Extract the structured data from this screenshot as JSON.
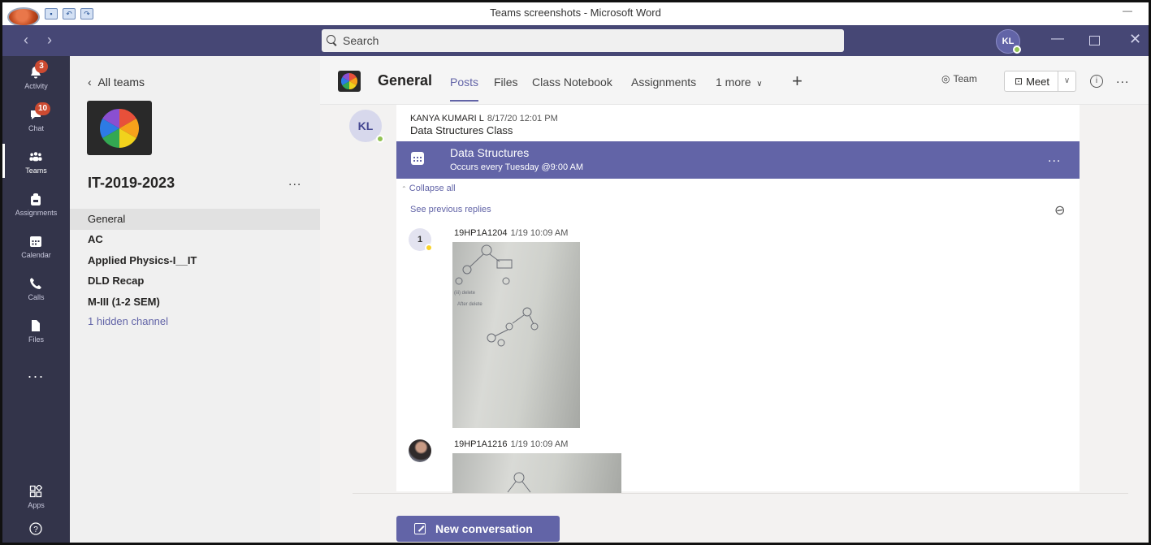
{
  "word": {
    "title": "Teams screenshots - Microsoft Word"
  },
  "search": {
    "placeholder": "Search"
  },
  "me": {
    "initials": "KL"
  },
  "rail": {
    "items": [
      {
        "label": "Activity",
        "badge": "3"
      },
      {
        "label": "Chat",
        "badge": "10"
      },
      {
        "label": "Teams",
        "badge": ""
      },
      {
        "label": "Assignments",
        "badge": ""
      },
      {
        "label": "Calendar",
        "badge": ""
      },
      {
        "label": "Calls",
        "badge": ""
      },
      {
        "label": "Files",
        "badge": ""
      }
    ],
    "more": "...",
    "apps": "Apps"
  },
  "channel_pane": {
    "back_label": "All teams",
    "team_name": "IT-2019-2023",
    "team_more": "...",
    "channels": [
      {
        "name": "General",
        "active": true,
        "bold": false
      },
      {
        "name": "AC",
        "active": false,
        "bold": true
      },
      {
        "name": "Applied Physics-I__IT",
        "active": false,
        "bold": true
      },
      {
        "name": "DLD Recap",
        "active": false,
        "bold": true
      },
      {
        "name": "M-III (1-2 SEM)",
        "active": false,
        "bold": true
      }
    ],
    "hidden_channels": "1 hidden channel"
  },
  "header": {
    "title": "General",
    "tabs": [
      "Posts",
      "Files",
      "Class Notebook",
      "Assignments",
      "1 more"
    ],
    "team_label": "Team",
    "meet_label": "Meet",
    "more": "..."
  },
  "post": {
    "author_initials": "KL",
    "author": "KANYA KUMARI L",
    "timestamp": "8/17/20 12:01 PM",
    "subject": "Data Structures Class",
    "meeting": {
      "title": "Data Structures",
      "recurrence": "Occurs every Tuesday @9:00 AM",
      "more": "..."
    },
    "collapse_all": "Collapse all",
    "see_previous": "See previous replies",
    "replies": [
      {
        "avatar_text": "1",
        "author": "19HP1A1204",
        "timestamp": "1/19 10:09 AM"
      },
      {
        "avatar_text": "",
        "author": "19HP1A1216",
        "timestamp": "1/19 10:09 AM"
      }
    ]
  },
  "composer": {
    "new_conversation": "New conversation"
  },
  "colors": {
    "accent": "#6264a7",
    "titlebar": "#464775",
    "rail": "#33344a",
    "badge": "#cc4a31",
    "presence_available": "#92c353"
  }
}
